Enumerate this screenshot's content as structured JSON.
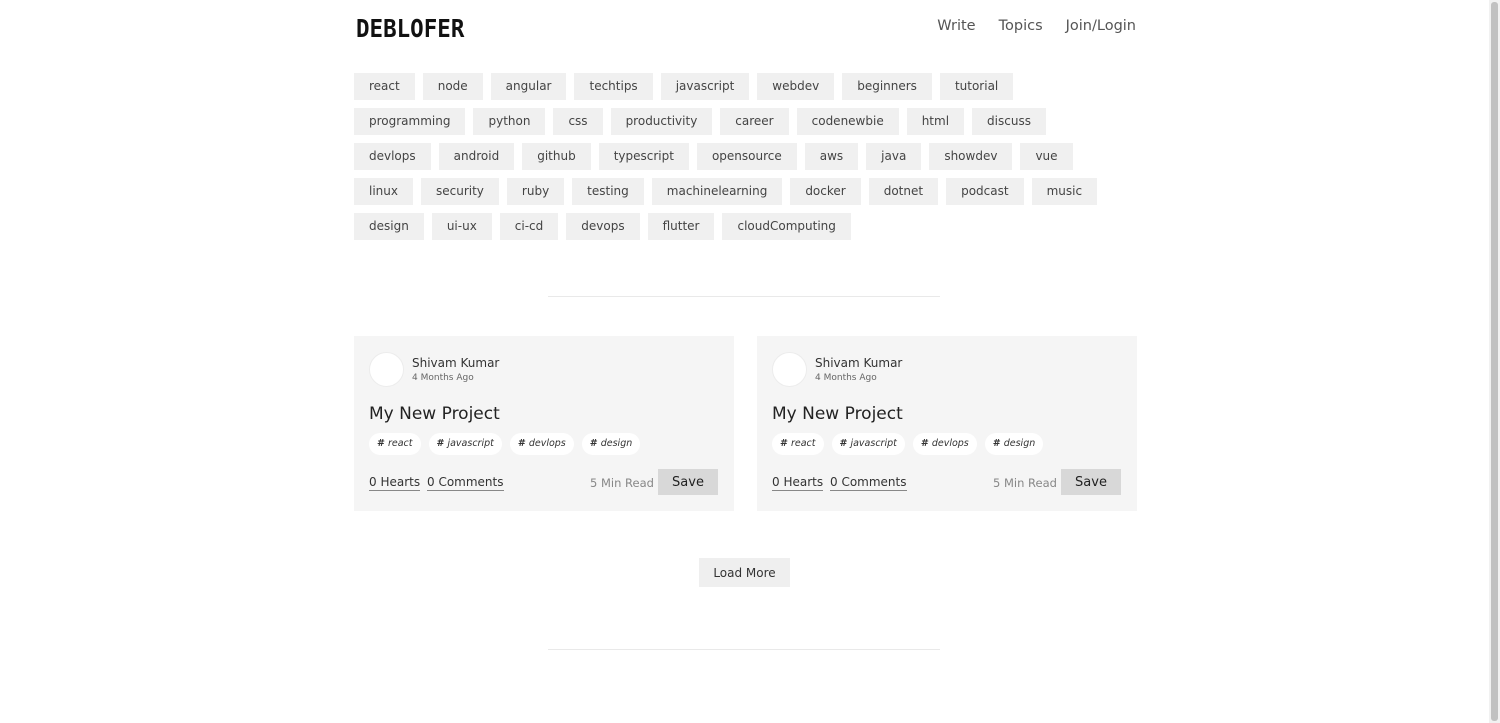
{
  "header": {
    "logo": "DEBLOFER",
    "nav": [
      "Write",
      "Topics",
      "Join/Login"
    ]
  },
  "tags": [
    "react",
    "node",
    "angular",
    "techtips",
    "javascript",
    "webdev",
    "beginners",
    "tutorial",
    "programming",
    "python",
    "css",
    "productivity",
    "career",
    "codenewbie",
    "html",
    "discuss",
    "devlops",
    "android",
    "github",
    "typescript",
    "opensource",
    "aws",
    "java",
    "showdev",
    "vue",
    "linux",
    "security",
    "ruby",
    "testing",
    "machinelearning",
    "docker",
    "dotnet",
    "podcast",
    "music",
    "design",
    "ui-ux",
    "ci-cd",
    "devops",
    "flutter",
    "cloudComputing"
  ],
  "posts": [
    {
      "author": "Shivam Kumar",
      "time": "4 Months Ago",
      "title": "My New Project",
      "tags": [
        "react",
        "javascript",
        "devlops",
        "design"
      ],
      "hearts": "0 Hearts",
      "comments": "0 Comments",
      "read_time": "5 Min Read",
      "save_label": "Save"
    },
    {
      "author": "Shivam Kumar",
      "time": "4 Months Ago",
      "title": "My New Project",
      "tags": [
        "react",
        "javascript",
        "devlops",
        "design"
      ],
      "hearts": "0 Hearts",
      "comments": "0 Comments",
      "read_time": "5 Min Read",
      "save_label": "Save"
    }
  ],
  "load_more_label": "Load More"
}
